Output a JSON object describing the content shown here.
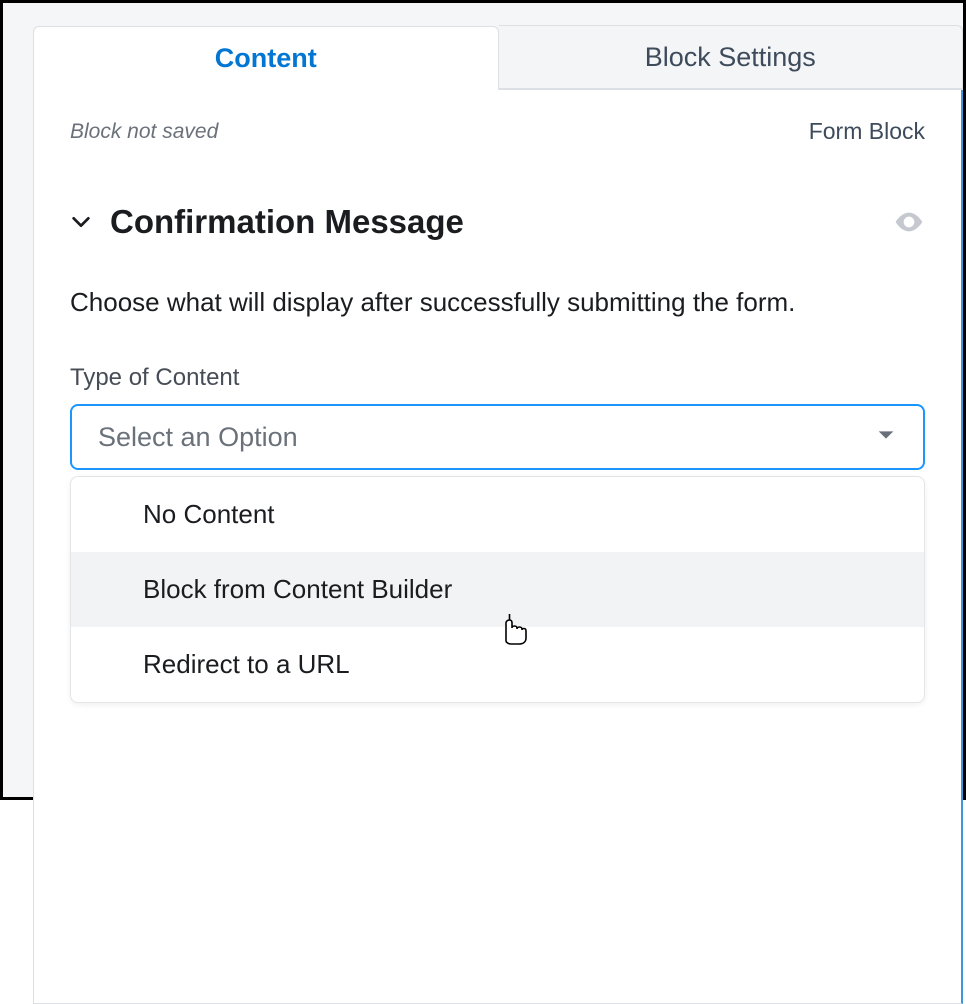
{
  "tabs": {
    "content": "Content",
    "block_settings": "Block Settings"
  },
  "status": {
    "left": "Block not saved",
    "right": "Form Block"
  },
  "section": {
    "title": "Confirmation Message",
    "description": "Choose what will display after successfully submitting the form."
  },
  "field": {
    "label": "Type of Content",
    "placeholder": "Select an Option",
    "options": [
      "No Content",
      "Block from Content Builder",
      "Redirect to a URL"
    ]
  }
}
